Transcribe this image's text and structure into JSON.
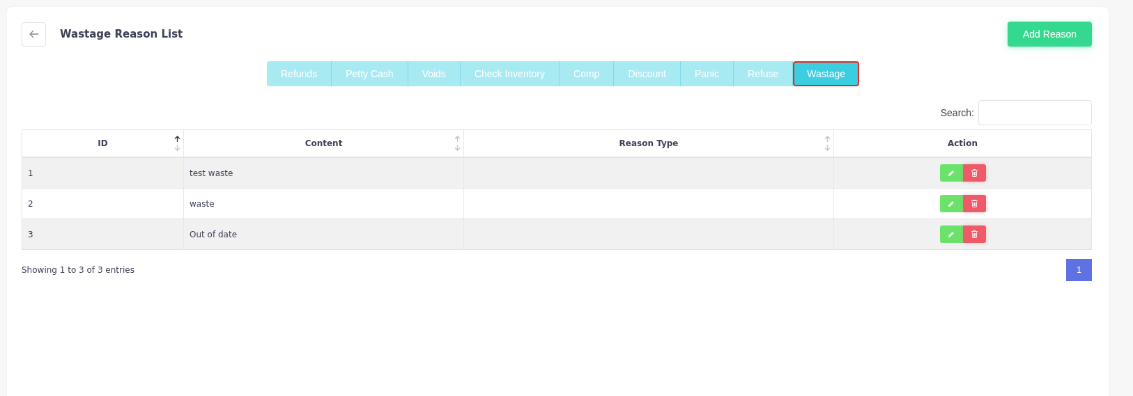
{
  "header": {
    "title": "Wastage Reason List",
    "add_button": "Add Reason"
  },
  "tabs": [
    {
      "label": "Refunds",
      "selected": false
    },
    {
      "label": "Petty Cash",
      "selected": false
    },
    {
      "label": "Voids",
      "selected": false
    },
    {
      "label": "Check Inventory",
      "selected": false
    },
    {
      "label": "Comp",
      "selected": false
    },
    {
      "label": "Discount",
      "selected": false
    },
    {
      "label": "Panic",
      "selected": false
    },
    {
      "label": "Refuse",
      "selected": false
    },
    {
      "label": "Wastage",
      "selected": true
    }
  ],
  "search": {
    "label": "Search:"
  },
  "table": {
    "columns": [
      {
        "label": "ID",
        "sorted": true
      },
      {
        "label": "Content",
        "sorted": false
      },
      {
        "label": "Reason Type",
        "sorted": false
      },
      {
        "label": "Action"
      }
    ],
    "rows": [
      {
        "id": "1",
        "content": "test waste"
      },
      {
        "id": "2",
        "content": "waste"
      },
      {
        "id": "3",
        "content": "Out of date"
      }
    ]
  },
  "footer": {
    "info": "Showing 1 to 3 of 3 entries",
    "pages": [
      {
        "label": "1",
        "selected": true
      }
    ]
  }
}
